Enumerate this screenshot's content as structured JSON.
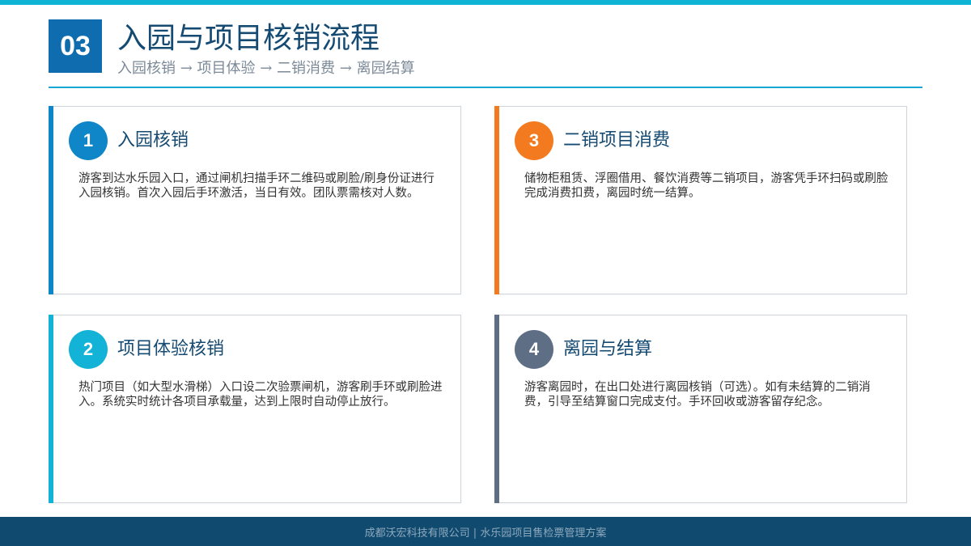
{
  "header": {
    "number": "03",
    "title": "入园与项目核销流程",
    "subtitle": "入园核销 → 项目体验 → 二销消费 → 离园结算",
    "number_bg": "#0f6cae",
    "accent_line": "#1aa6d2"
  },
  "cards": [
    {
      "badge": "1",
      "title": "入园核销",
      "body": "游客到达水乐园入口，通过闸机扫描手环二维码或刷脸/刷身份证进行入园核销。首次入园后手环激活，当日有效。团队票需核对人数。",
      "color": "#0f86c8"
    },
    {
      "badge": "2",
      "title": "项目体验核销",
      "body": "热门项目（如大型水滑梯）入口设二次验票闸机，游客刷手环或刷脸进入。系统实时统计各项目承载量，达到上限时自动停止放行。",
      "color": "#12b3d6"
    },
    {
      "badge": "3",
      "title": "二销项目消费",
      "body": "储物柜租赁、浮圈借用、餐饮消费等二销项目，游客凭手环扫码或刷脸完成消费扣费，离园时统一结算。",
      "color": "#f47a20"
    },
    {
      "badge": "4",
      "title": "离园与结算",
      "body": "游客离园时，在出口处进行离园核销（可选）。如有未结算的二销消费，引导至结算窗口完成支付。手环回收或游客留存纪念。",
      "color": "#5d6e85"
    }
  ],
  "footer": {
    "text": "成都沃宏科技有限公司 | 水乐园项目售检票管理方案"
  }
}
